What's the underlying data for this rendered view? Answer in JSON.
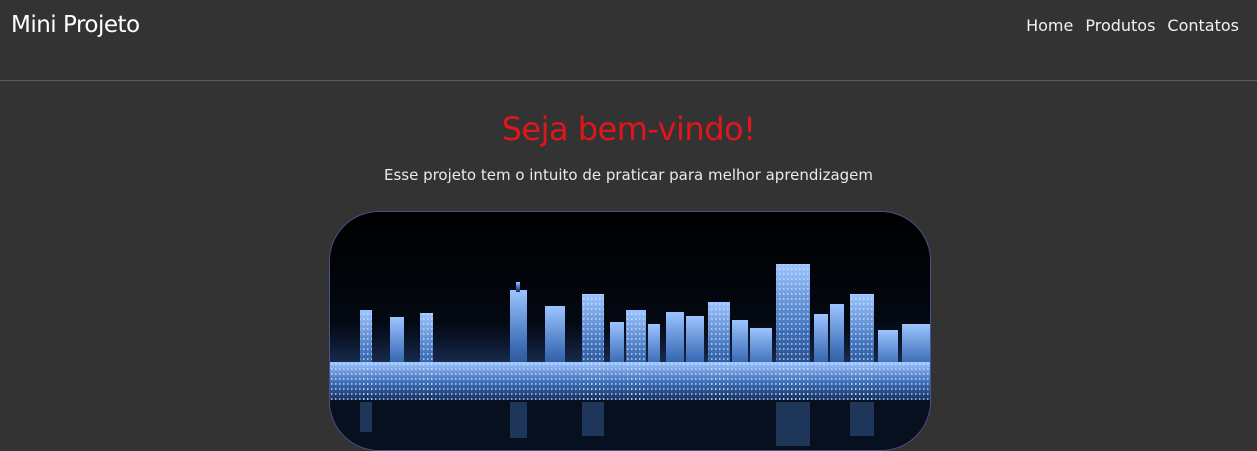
{
  "header": {
    "brand": "Mini Projeto",
    "nav": [
      {
        "label": "Home"
      },
      {
        "label": "Produtos"
      },
      {
        "label": "Contatos"
      }
    ]
  },
  "main": {
    "title": "Seja bem-vindo!",
    "subtitle": "Esse projeto tem o intuito de praticar para melhor aprendizagem",
    "hero_image": "city-skyline-night"
  },
  "colors": {
    "background": "#333333",
    "title": "#e0161b",
    "accent_border": "#4a4f8f"
  }
}
